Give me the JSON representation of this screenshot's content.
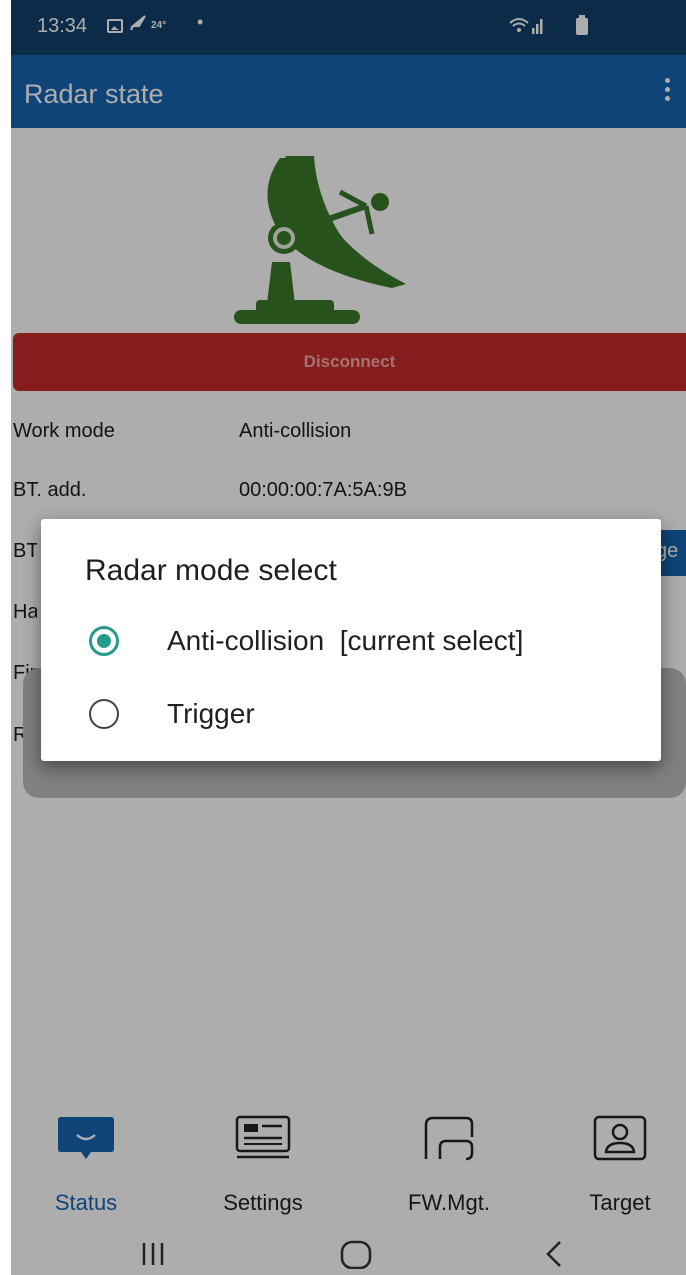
{
  "status_bar": {
    "time": "13:34",
    "temperature": "24°",
    "notification_dot": "•",
    "icons": [
      "gallery-icon",
      "feather-icon",
      "wifi-icon",
      "signal-icon",
      "battery-icon"
    ]
  },
  "app_bar": {
    "title": "Radar state",
    "menu_icon": "more-vertical-icon"
  },
  "content": {
    "radar_icon": "radar-dish-icon",
    "disconnect_label": "Disconnect",
    "info_rows": [
      {
        "label": "Work mode",
        "value": "Anti-collision"
      },
      {
        "label": "BT. add.",
        "value": "00:00:00:7A:5A:9B"
      }
    ],
    "partial_labels": [
      "BT",
      "Ha",
      "Fir",
      "Ra"
    ],
    "side_button_label": "ge"
  },
  "dialog": {
    "title": "Radar mode select",
    "options": [
      {
        "label": "Anti-collision  [current select]",
        "selected": true
      },
      {
        "label": "Trigger",
        "selected": false
      }
    ]
  },
  "bottom_nav": {
    "items": [
      {
        "label": "Status",
        "icon": "status-icon",
        "active": true
      },
      {
        "label": "Settings",
        "icon": "settings-icon",
        "active": false
      },
      {
        "label": "FW.Mgt.",
        "icon": "fw-mgt-icon",
        "active": false
      },
      {
        "label": "Target",
        "icon": "target-icon",
        "active": false
      }
    ]
  },
  "system_nav": {
    "buttons": [
      "recent-apps-icon",
      "home-icon",
      "back-icon"
    ]
  },
  "colors": {
    "status_bar": "#12406b",
    "app_bar": "#1565b0",
    "disconnect": "#c42b2b",
    "radio_accent": "#26998a",
    "radar_green": "#3a7a2a"
  }
}
